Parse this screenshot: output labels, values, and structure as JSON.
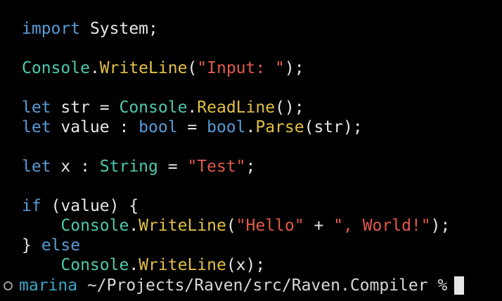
{
  "colors": {
    "background": "#000000",
    "keyword": "#569cd6",
    "type": "#4ec9b0",
    "method": "#e2c044",
    "string": "#e35a4a",
    "text": "#e6e6e6",
    "prompt_user": "#3aa6c9"
  },
  "editor": {
    "lines": [
      [
        {
          "t": "kw",
          "v": "import"
        },
        {
          "t": "plain",
          "v": " System;"
        }
      ],
      [],
      [
        {
          "t": "type",
          "v": "Console"
        },
        {
          "t": "plain",
          "v": "."
        },
        {
          "t": "fnb",
          "v": "WriteLine"
        },
        {
          "t": "plain",
          "v": "("
        },
        {
          "t": "str",
          "v": "\"Input: \""
        },
        {
          "t": "plain",
          "v": ");"
        }
      ],
      [],
      [
        {
          "t": "kw",
          "v": "let"
        },
        {
          "t": "plain",
          "v": " str = "
        },
        {
          "t": "type",
          "v": "Console"
        },
        {
          "t": "plain",
          "v": "."
        },
        {
          "t": "fnb",
          "v": "ReadLine"
        },
        {
          "t": "plain",
          "v": "();"
        }
      ],
      [
        {
          "t": "kw",
          "v": "let"
        },
        {
          "t": "plain",
          "v": " value : "
        },
        {
          "t": "kw",
          "v": "bool"
        },
        {
          "t": "plain",
          "v": " = "
        },
        {
          "t": "kw",
          "v": "bool"
        },
        {
          "t": "plain",
          "v": "."
        },
        {
          "t": "fnb",
          "v": "Parse"
        },
        {
          "t": "plain",
          "v": "(str);"
        }
      ],
      [],
      [
        {
          "t": "kw",
          "v": "let"
        },
        {
          "t": "plain",
          "v": " x : "
        },
        {
          "t": "type",
          "v": "String"
        },
        {
          "t": "plain",
          "v": " = "
        },
        {
          "t": "str",
          "v": "\"Test\""
        },
        {
          "t": "plain",
          "v": ";"
        }
      ],
      [],
      [
        {
          "t": "kw",
          "v": "if"
        },
        {
          "t": "plain",
          "v": " (value) {"
        }
      ],
      [
        {
          "t": "plain",
          "v": "    "
        },
        {
          "t": "type",
          "v": "Console"
        },
        {
          "t": "plain",
          "v": "."
        },
        {
          "t": "fnb",
          "v": "WriteLine"
        },
        {
          "t": "plain",
          "v": "("
        },
        {
          "t": "str",
          "v": "\"Hello\""
        },
        {
          "t": "plain",
          "v": " + "
        },
        {
          "t": "str",
          "v": "\", World!\""
        },
        {
          "t": "plain",
          "v": ");"
        }
      ],
      [
        {
          "t": "plain",
          "v": "} "
        },
        {
          "t": "kw",
          "v": "else"
        }
      ],
      [
        {
          "t": "plain",
          "v": "    "
        },
        {
          "t": "type",
          "v": "Console"
        },
        {
          "t": "plain",
          "v": "."
        },
        {
          "t": "fnb",
          "v": "WriteLine"
        },
        {
          "t": "plain",
          "v": "(x);"
        }
      ]
    ]
  },
  "terminal": {
    "user": "marina",
    "path": " ~/Projects/Raven/src/Raven.Compiler %"
  }
}
